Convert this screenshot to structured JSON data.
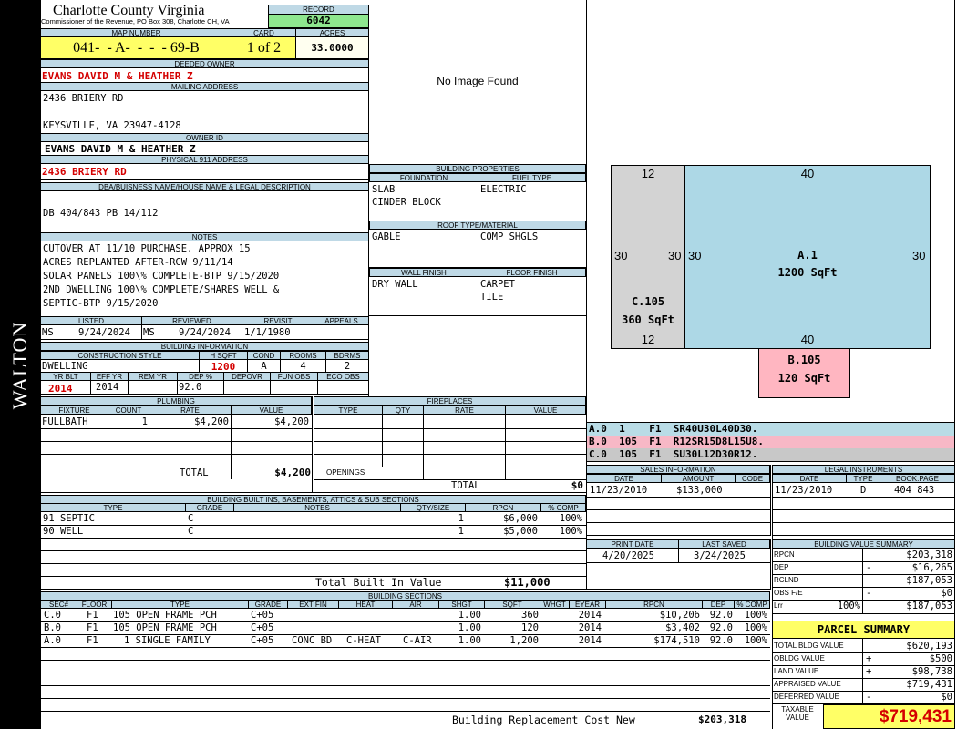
{
  "side_label": "WALTON",
  "header": {
    "county": "Charlotte County Virginia",
    "office": "Commissioner of the Revenue, PO Box 308, Charlotte CH, VA",
    "record_label": "RECORD",
    "record": "6042",
    "map_label": "MAP NUMBER",
    "map": "041-  - A-  -  -  - 69-B",
    "card_label": "CARD",
    "card": "1 of 2",
    "acres_label": "ACRES",
    "acres": "33.0000"
  },
  "owner": {
    "deeded_label": "DEEDED OWNER",
    "deeded": "EVANS DAVID M & HEATHER Z",
    "mailing_label": "MAILING ADDRESS",
    "mailing1": "2436 BRIERY RD",
    "mailing2": "KEYSVILLE, VA 23947-4128",
    "owner_id_label": "OWNER ID",
    "owner_id": "EVANS DAVID M & HEATHER Z",
    "physical_label": "PHYSICAL 911 ADDRESS",
    "physical": "2436 BRIERY RD",
    "dba_label": "DBA/BUISNESS NAME/HOUSE NAME & LEGAL DESCRIPTION",
    "dba": "DB 404/843 PB 14/112"
  },
  "notes": {
    "label": "NOTES",
    "lines": [
      "CUTOVER AT 11/10 PURCHASE. APPROX 15",
      "ACRES REPLANTED AFTER-RCW 9/11/14",
      "SOLAR PANELS 100\\% COMPLETE-BTP 9/15/2020",
      "2ND DWELLING 100\\% COMPLETE/SHARES WELL &",
      "SEPTIC-BTP 9/15/2020"
    ]
  },
  "review": {
    "listed_label": "LISTED",
    "listed_by": "MS",
    "listed_date": "9/24/2024",
    "reviewed_label": "REVIEWED",
    "reviewed_by": "MS",
    "reviewed_date": "9/24/2024",
    "revisit_label": "REVISIT",
    "revisit": "1/1/1980",
    "appeals_label": "APPEALS",
    "appeals": ""
  },
  "building_info": {
    "label": "BUILDING INFORMATION",
    "style_label": "CONSTRUCTION STYLE",
    "style": "DWELLING",
    "hsqft_label": "H SQFT",
    "hsqft": "1200",
    "cond_label": "COND",
    "cond": "A",
    "rooms_label": "ROOMS",
    "rooms": "4",
    "bdrms_label": "BDRMS",
    "bdrms": "2",
    "yrblt_label": "YR BLT",
    "yrblt": "2014",
    "effyr_label": "EFF YR",
    "effyr": "2014",
    "remyr_label": "REM YR",
    "remyr": "",
    "dep_label": "DEP %",
    "dep": "92.0",
    "depovr_label": "DEPOVR",
    "funobs_label": "FUN OBS",
    "ecoobs_label": "ECO OBS"
  },
  "photo": {
    "text": "No Image Found"
  },
  "building_properties": {
    "label": "BUILDING PROPERTIES",
    "foundation_label": "FOUNDATION",
    "foundation": [
      "SLAB",
      "CINDER BLOCK"
    ],
    "fuel_label": "FUEL TYPE",
    "fuel": "ELECTRIC",
    "roof_label": "ROOF TYPE/MATERIAL",
    "roof_type": "GABLE",
    "roof_material": "COMP SHGLS",
    "wall_label": "WALL FINISH",
    "wall": "DRY WALL",
    "floor_label": "FLOOR FINISH",
    "floor": [
      "CARPET",
      "TILE"
    ]
  },
  "sketch": {
    "c105": {
      "name": "C.105",
      "area": "360 SqFt",
      "top": "12",
      "bottom": "12",
      "left": "30",
      "right": "30"
    },
    "a1": {
      "name": "A.1",
      "area": "1200 SqFt",
      "top": "40",
      "bottom": "40",
      "left": "30",
      "right": "30"
    },
    "b105": {
      "name": "B.105",
      "area": "120 SqFt"
    },
    "legend": [
      {
        "text": "A.0  1    F1  SR40U30L40D30.",
        "color": "#b9dce6"
      },
      {
        "text": "B.0  105  F1  R12SR15D8L15U8.",
        "color": "#f7b8c6"
      },
      {
        "text": "C.0  105  F1  SU30L12D30R12.",
        "color": "#c8c8c8"
      }
    ],
    "colors": {
      "a": "#add8e6",
      "b": "#ffb6c1",
      "c": "#d3d3d3"
    }
  },
  "plumbing": {
    "label": "PLUMBING",
    "headers": [
      "FIXTURE",
      "COUNT",
      "RATE",
      "VALUE"
    ],
    "rows": [
      {
        "fixture": "FULLBATH",
        "count": "1",
        "rate": "$4,200",
        "value": "$4,200"
      }
    ],
    "total_label": "TOTAL",
    "total": "$4,200"
  },
  "fireplaces": {
    "label": "FIREPLACES",
    "headers": [
      "TYPE",
      "QTY",
      "RATE",
      "VALUE"
    ],
    "openings_label": "OPENINGS",
    "total_label": "TOTAL",
    "total": "$0"
  },
  "sales": {
    "label": "SALES INFORMATION",
    "headers": [
      "DATE",
      "AMOUNT",
      "CODE"
    ],
    "rows": [
      {
        "date": "11/23/2010",
        "amount": "$133,000",
        "code": ""
      }
    ]
  },
  "legal": {
    "label": "LEGAL INSTRUMENTS",
    "headers": [
      "DATE",
      "TYPE",
      "BOOK.PAGE"
    ],
    "rows": [
      {
        "date": "11/23/2010",
        "type": "D",
        "book": "404 843"
      }
    ]
  },
  "dates": {
    "print_label": "PRINT DATE",
    "print": "4/20/2025",
    "saved_label": "LAST SAVED",
    "saved": "3/24/2025"
  },
  "builtins": {
    "label": "BUILDING BUILT INS, BASEMENTS, ATTICS & SUB SECTIONS",
    "headers": [
      "TYPE",
      "GRADE",
      "NOTES",
      "QTY/SIZE",
      "RPCN",
      "% COMP"
    ],
    "rows": [
      {
        "type": "91 SEPTIC",
        "grade": "C",
        "notes": "",
        "qty": "1",
        "rpcn": "$6,000",
        "comp": "100%"
      },
      {
        "type": "90 WELL",
        "grade": "C",
        "notes": "",
        "qty": "1",
        "rpcn": "$5,000",
        "comp": "100%"
      }
    ],
    "total_label": "Total Built In Value",
    "total": "$11,000"
  },
  "value_summary": {
    "label": "BUILDING VALUE SUMMARY",
    "rows": [
      {
        "label": "RPCN",
        "sign": "",
        "value": "$203,318"
      },
      {
        "label": "DEP",
        "sign": "-",
        "value": "$16,265"
      },
      {
        "label": "RCLND",
        "sign": "",
        "value": "$187,053"
      },
      {
        "label": "OBS F/E",
        "sign": "-",
        "value": "$0"
      },
      {
        "label": "Lrr",
        "sign": "100%",
        "value": "$187,053"
      }
    ]
  },
  "sections": {
    "label": "BUILDING SECTIONS",
    "headers": [
      "SEC#",
      "FLOOR",
      "TYPE",
      "GRADE",
      "EXT FIN",
      "HEAT",
      "AIR",
      "SHGT",
      "SQFT",
      "WHGT",
      "EYEAR",
      "RPCN",
      "DEP",
      "% COMP"
    ],
    "rows": [
      {
        "sec": "C.0",
        "floor": "F1",
        "type": "105 OPEN FRAME PCH",
        "grade": "C+05",
        "ext": "",
        "heat": "",
        "air": "",
        "shgt": "1.00",
        "sqft": "360",
        "whgt": "",
        "eyear": "2014",
        "rpcn": "$10,206",
        "dep": "92.0",
        "comp": "100%"
      },
      {
        "sec": "B.0",
        "floor": "F1",
        "type": "105 OPEN FRAME PCH",
        "grade": "C+05",
        "ext": "",
        "heat": "",
        "air": "",
        "shgt": "1.00",
        "sqft": "120",
        "whgt": "",
        "eyear": "2014",
        "rpcn": "$3,402",
        "dep": "92.0",
        "comp": "100%"
      },
      {
        "sec": "A.0",
        "floor": "F1",
        "type": "1 SINGLE FAMILY",
        "grade": "C+05",
        "ext": "CONC BD",
        "heat": "C-HEAT",
        "air": "C-AIR",
        "shgt": "1.00",
        "sqft": "1,200",
        "whgt": "",
        "eyear": "2014",
        "rpcn": "$174,510",
        "dep": "92.0",
        "comp": "100%"
      }
    ],
    "total_label": "Building Replacement Cost New",
    "total": "$203,318"
  },
  "parcel": {
    "label": "PARCEL SUMMARY",
    "rows": [
      {
        "label": "TOTAL BLDG VALUE",
        "sign": "",
        "value": "$620,193"
      },
      {
        "label": "OBLDG VALUE",
        "sign": "+",
        "value": "$500"
      },
      {
        "label": "LAND VALUE",
        "sign": "+",
        "value": "$98,738"
      },
      {
        "label": "APPRAISED VALUE",
        "sign": "",
        "value": "$719,431"
      },
      {
        "label": "DEFERRED VALUE",
        "sign": "-",
        "value": "$0"
      }
    ],
    "taxable_label1": "TAXABLE",
    "taxable_label2": "VALUE",
    "taxable": "$719,431"
  }
}
